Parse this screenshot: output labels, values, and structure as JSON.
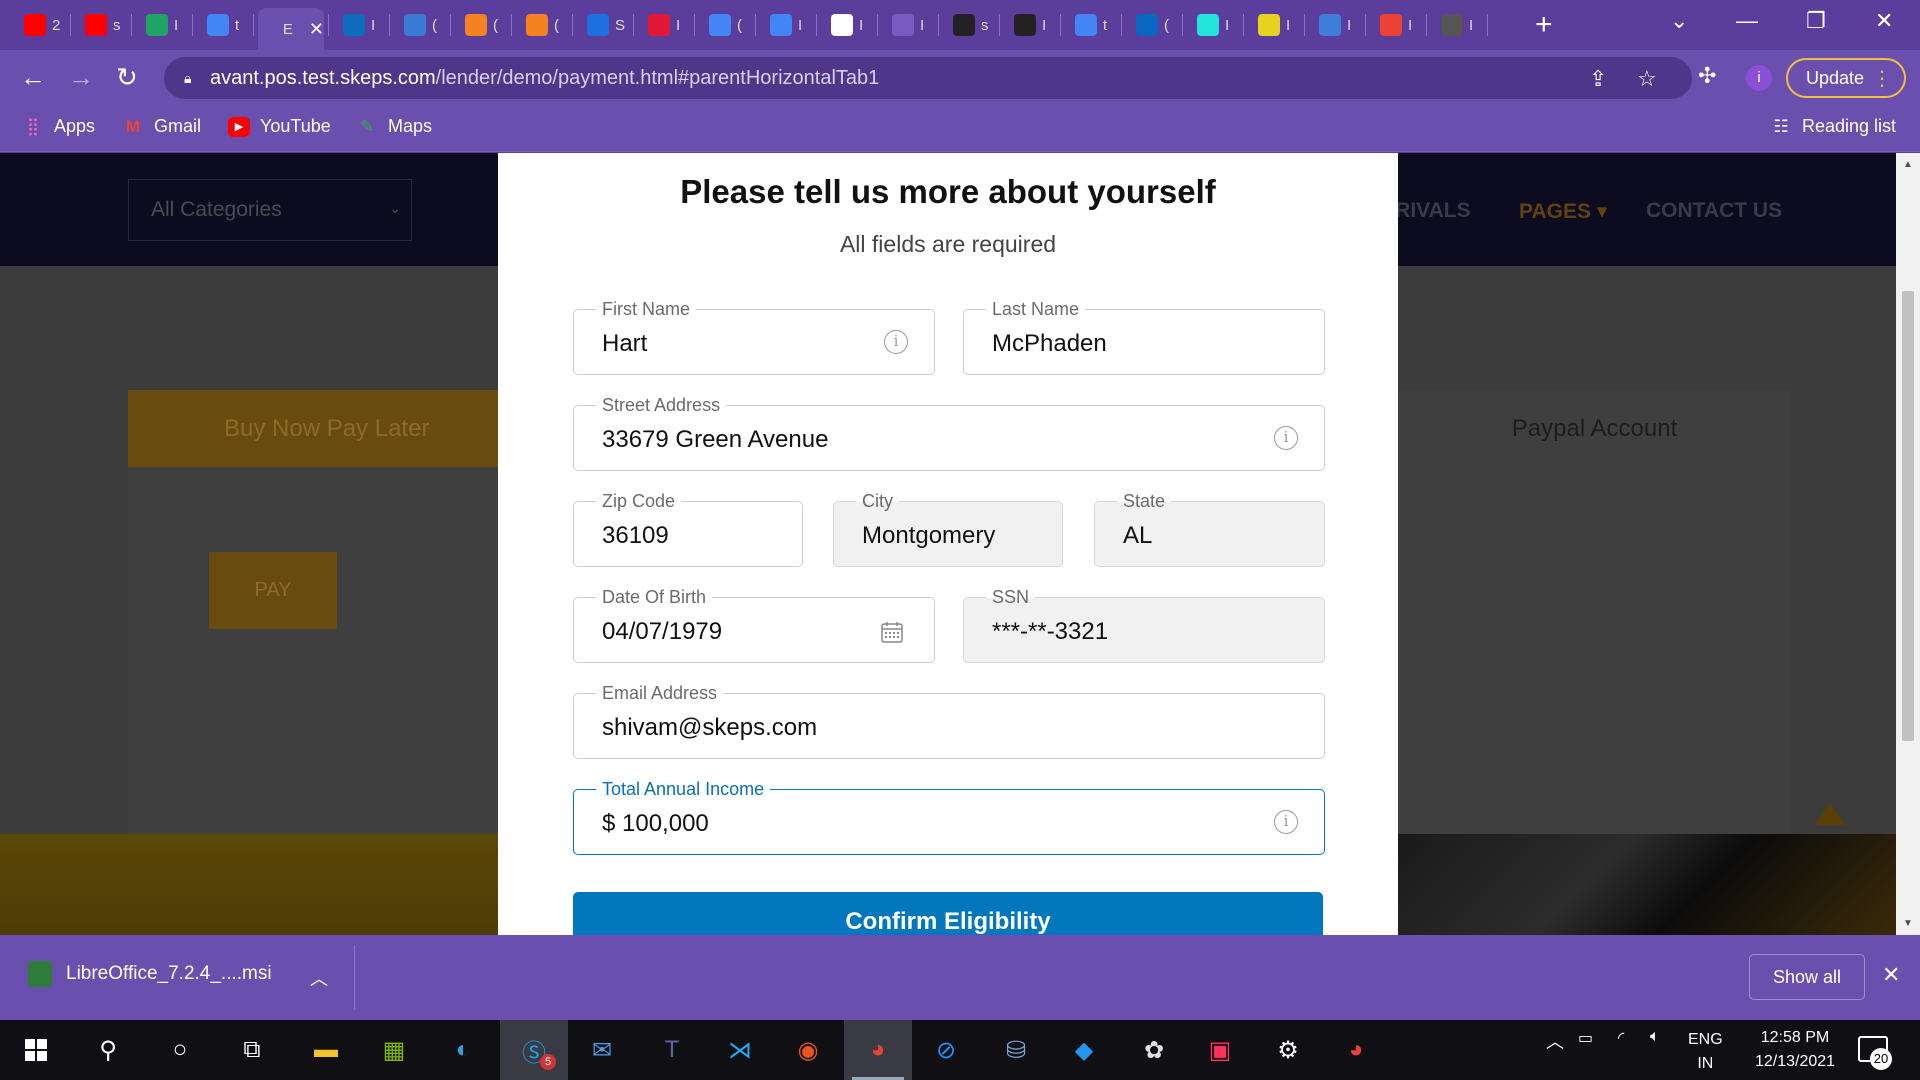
{
  "browser": {
    "tabs": [
      {
        "favicon": "youtube-icon",
        "title": "2",
        "color": "#ff0000"
      },
      {
        "favicon": "youtube-icon",
        "title": "s",
        "color": "#ff0000"
      },
      {
        "favicon": "google-drive-icon",
        "title": "I",
        "color": "#1fa463"
      },
      {
        "favicon": "google-icon",
        "title": "t",
        "color": "#4285f4"
      },
      {
        "favicon": "page-icon",
        "title": "E",
        "color": "#6b4fae",
        "active": true
      },
      {
        "favicon": "onedrive-icon",
        "title": "I",
        "color": "#0f6cbd"
      },
      {
        "favicon": "bot-icon",
        "title": "(",
        "color": "#3a7bd5"
      },
      {
        "favicon": "app-icon",
        "title": "(",
        "color": "#f58220"
      },
      {
        "favicon": "app-icon",
        "title": "(",
        "color": "#f58220"
      },
      {
        "favicon": "app-icon",
        "title": "S",
        "color": "#1e6fe0"
      },
      {
        "favicon": "v-icon",
        "title": "I",
        "color": "#e31837"
      },
      {
        "favicon": "google-icon",
        "title": "(",
        "color": "#4285f4"
      },
      {
        "favicon": "google-icon",
        "title": "I",
        "color": "#4285f4"
      },
      {
        "favicon": "doc-icon",
        "title": "I",
        "color": "#ffffff"
      },
      {
        "favicon": "n-icon",
        "title": "I",
        "color": "#7a5cc0"
      },
      {
        "favicon": "github-icon",
        "title": "s",
        "color": "#222"
      },
      {
        "favicon": "github-icon",
        "title": "I",
        "color": "#222"
      },
      {
        "favicon": "google-icon",
        "title": "t",
        "color": "#4285f4"
      },
      {
        "favicon": "linkedin-icon",
        "title": "(",
        "color": "#0a66c2"
      },
      {
        "favicon": "olx-icon",
        "title": "I",
        "color": "#23e5db"
      },
      {
        "favicon": "download-icon",
        "title": "I",
        "color": "#e6d21f"
      },
      {
        "favicon": "tu-icon",
        "title": "I",
        "color": "#3b7dd8"
      },
      {
        "favicon": "gmail-icon",
        "title": "I",
        "color": "#ea4335"
      },
      {
        "favicon": "app-icon",
        "title": "I",
        "color": "#555"
      }
    ],
    "active_tab_close": "✕",
    "new_tab": "+",
    "window_controls": {
      "list": "⌄",
      "minimize": "—",
      "restore": "❐",
      "close": "✕"
    },
    "url_host": "avant.pos.test.skeps.com",
    "url_path": "/lender/demo/payment.html#parentHorizontalTab1",
    "update_label": "Update",
    "profile_initial": "i",
    "bookmarks": [
      {
        "label": "Apps",
        "icon": "apps-grid-icon"
      },
      {
        "label": "Gmail",
        "icon": "gmail-icon"
      },
      {
        "label": "YouTube",
        "icon": "youtube-icon"
      },
      {
        "label": "Maps",
        "icon": "maps-icon"
      }
    ],
    "reading_list": "Reading list"
  },
  "background_page": {
    "categories_placeholder": "All Categories",
    "menu": [
      {
        "label": "RRIVALS",
        "highlight": false
      },
      {
        "label": "PAGES",
        "highlight": true
      },
      {
        "label": "CONTACT US",
        "highlight": false
      }
    ],
    "tab_bnpl": "Buy Now Pay Later",
    "tab_paypal": "Paypal Account",
    "pay_button": "PAY"
  },
  "modal": {
    "title": "Please tell us more about yourself",
    "subtitle": "All fields are required",
    "fields": {
      "first_name": {
        "label": "First Name",
        "value": "Hart"
      },
      "last_name": {
        "label": "Last Name",
        "value": "McPhaden"
      },
      "street": {
        "label": "Street Address",
        "value": "33679 Green Avenue"
      },
      "zip": {
        "label": "Zip Code",
        "value": "36109"
      },
      "city": {
        "label": "City",
        "value": "Montgomery"
      },
      "state": {
        "label": "State",
        "value": "AL"
      },
      "dob": {
        "label": "Date Of Birth",
        "value": "04/07/1979"
      },
      "ssn": {
        "label": "SSN",
        "value": "***-**-3321"
      },
      "email": {
        "label": "Email Address",
        "value": "shivam@skeps.com"
      },
      "income": {
        "label": "Total Annual Income",
        "value": "$ 100,000"
      }
    },
    "info_glyph": "i",
    "confirm_label": "Confirm Eligibility"
  },
  "download_bar": {
    "filename": "LibreOffice_7.2.4_....msi",
    "show_all": "Show all"
  },
  "taskbar": {
    "lang_top": "ENG",
    "lang_bottom": "IN",
    "time": "12:58 PM",
    "date": "12/13/2021",
    "notifications": "20",
    "skype_badge": "5"
  }
}
